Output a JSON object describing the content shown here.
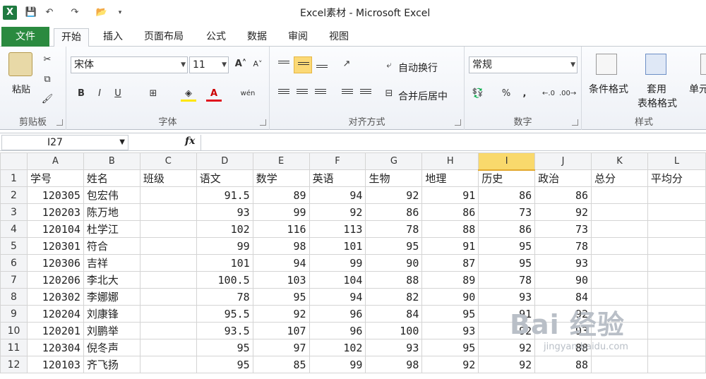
{
  "window": {
    "title": "Excel素材 - Microsoft Excel"
  },
  "tabs": [
    "文件",
    "开始",
    "插入",
    "页面布局",
    "公式",
    "数据",
    "审阅",
    "视图"
  ],
  "ribbon": {
    "clipboard": {
      "paste": "粘贴",
      "label": "剪贴板"
    },
    "font": {
      "name": "宋体",
      "size": "11",
      "label": "字体",
      "bold": "B",
      "italic": "I",
      "underline": "U"
    },
    "alignment": {
      "wrap": "自动换行",
      "merge": "合并后居中",
      "label": "对齐方式"
    },
    "number": {
      "format": "常规",
      "label": "数字",
      "percent": "%",
      "comma": ","
    },
    "styles": {
      "cond": "条件格式",
      "table_line1": "套用",
      "table_line2": "表格格式",
      "cell": "单元",
      "label": "样式"
    }
  },
  "formula_bar": {
    "name_box": "I27",
    "fx": "fx",
    "content": ""
  },
  "columns": [
    "A",
    "B",
    "C",
    "D",
    "E",
    "F",
    "G",
    "H",
    "I",
    "J",
    "K",
    "L"
  ],
  "selected_column": "I",
  "rows": [
    [
      "学号",
      "姓名",
      "班级",
      "语文",
      "数学",
      "英语",
      "生物",
      "地理",
      "历史",
      "政治",
      "总分",
      "平均分"
    ],
    [
      "120305",
      "包宏伟",
      "",
      "91.5",
      "89",
      "94",
      "92",
      "91",
      "86",
      "86",
      "",
      ""
    ],
    [
      "120203",
      "陈万地",
      "",
      "93",
      "99",
      "92",
      "86",
      "86",
      "73",
      "92",
      "",
      ""
    ],
    [
      "120104",
      "杜学江",
      "",
      "102",
      "116",
      "113",
      "78",
      "88",
      "86",
      "73",
      "",
      ""
    ],
    [
      "120301",
      "符合",
      "",
      "99",
      "98",
      "101",
      "95",
      "91",
      "95",
      "78",
      "",
      ""
    ],
    [
      "120306",
      "吉祥",
      "",
      "101",
      "94",
      "99",
      "90",
      "87",
      "95",
      "93",
      "",
      ""
    ],
    [
      "120206",
      "李北大",
      "",
      "100.5",
      "103",
      "104",
      "88",
      "89",
      "78",
      "90",
      "",
      ""
    ],
    [
      "120302",
      "李娜娜",
      "",
      "78",
      "95",
      "94",
      "82",
      "90",
      "93",
      "84",
      "",
      ""
    ],
    [
      "120204",
      "刘康锋",
      "",
      "95.5",
      "92",
      "96",
      "84",
      "95",
      "91",
      "92",
      "",
      ""
    ],
    [
      "120201",
      "刘鹏举",
      "",
      "93.5",
      "107",
      "96",
      "100",
      "93",
      "92",
      "93",
      "",
      ""
    ],
    [
      "120304",
      "倪冬声",
      "",
      "95",
      "97",
      "102",
      "93",
      "95",
      "92",
      "88",
      "",
      ""
    ],
    [
      "120103",
      "齐飞扬",
      "",
      "95",
      "85",
      "99",
      "98",
      "92",
      "92",
      "88",
      "",
      ""
    ]
  ],
  "watermark": {
    "big": "Bai 经验",
    "small": "jingyan.baidu.com"
  }
}
